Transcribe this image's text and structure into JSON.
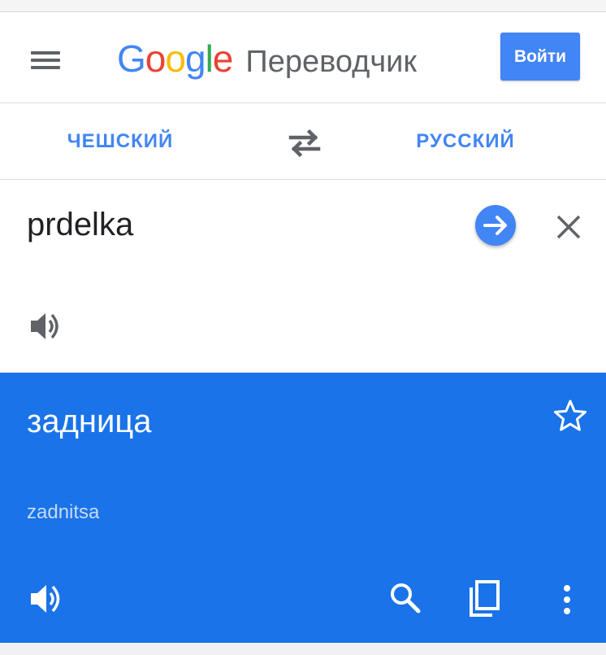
{
  "header": {
    "logo_letters": [
      {
        "char": "G",
        "color": "#4285F4"
      },
      {
        "char": "o",
        "color": "#EA4335"
      },
      {
        "char": "o",
        "color": "#FBBC05"
      },
      {
        "char": "g",
        "color": "#4285F4"
      },
      {
        "char": "l",
        "color": "#34A853"
      },
      {
        "char": "e",
        "color": "#EA4335"
      }
    ],
    "product_name": "Переводчик",
    "signin_label": "Войти",
    "menu_icon": "hamburger-menu-icon"
  },
  "languages": {
    "source": "ЧЕШСКИЙ",
    "target": "РУССКИЙ",
    "swap_icon": "swap-arrows-icon"
  },
  "input": {
    "text": "prdelka",
    "go_icon": "arrow-right-icon",
    "clear_icon": "close-icon",
    "speaker_icon": "speaker-icon"
  },
  "result": {
    "translation": "задница",
    "transliteration": "zadnitsa",
    "icons": [
      "star-outline-icon",
      "speaker-icon",
      "search-icon",
      "copy-icon",
      "more-vert-icon"
    ]
  },
  "colors": {
    "accent": "#4285F4",
    "result_bg": "#1A73E8",
    "icon_gray": "#5F6368",
    "text": "#202124"
  }
}
